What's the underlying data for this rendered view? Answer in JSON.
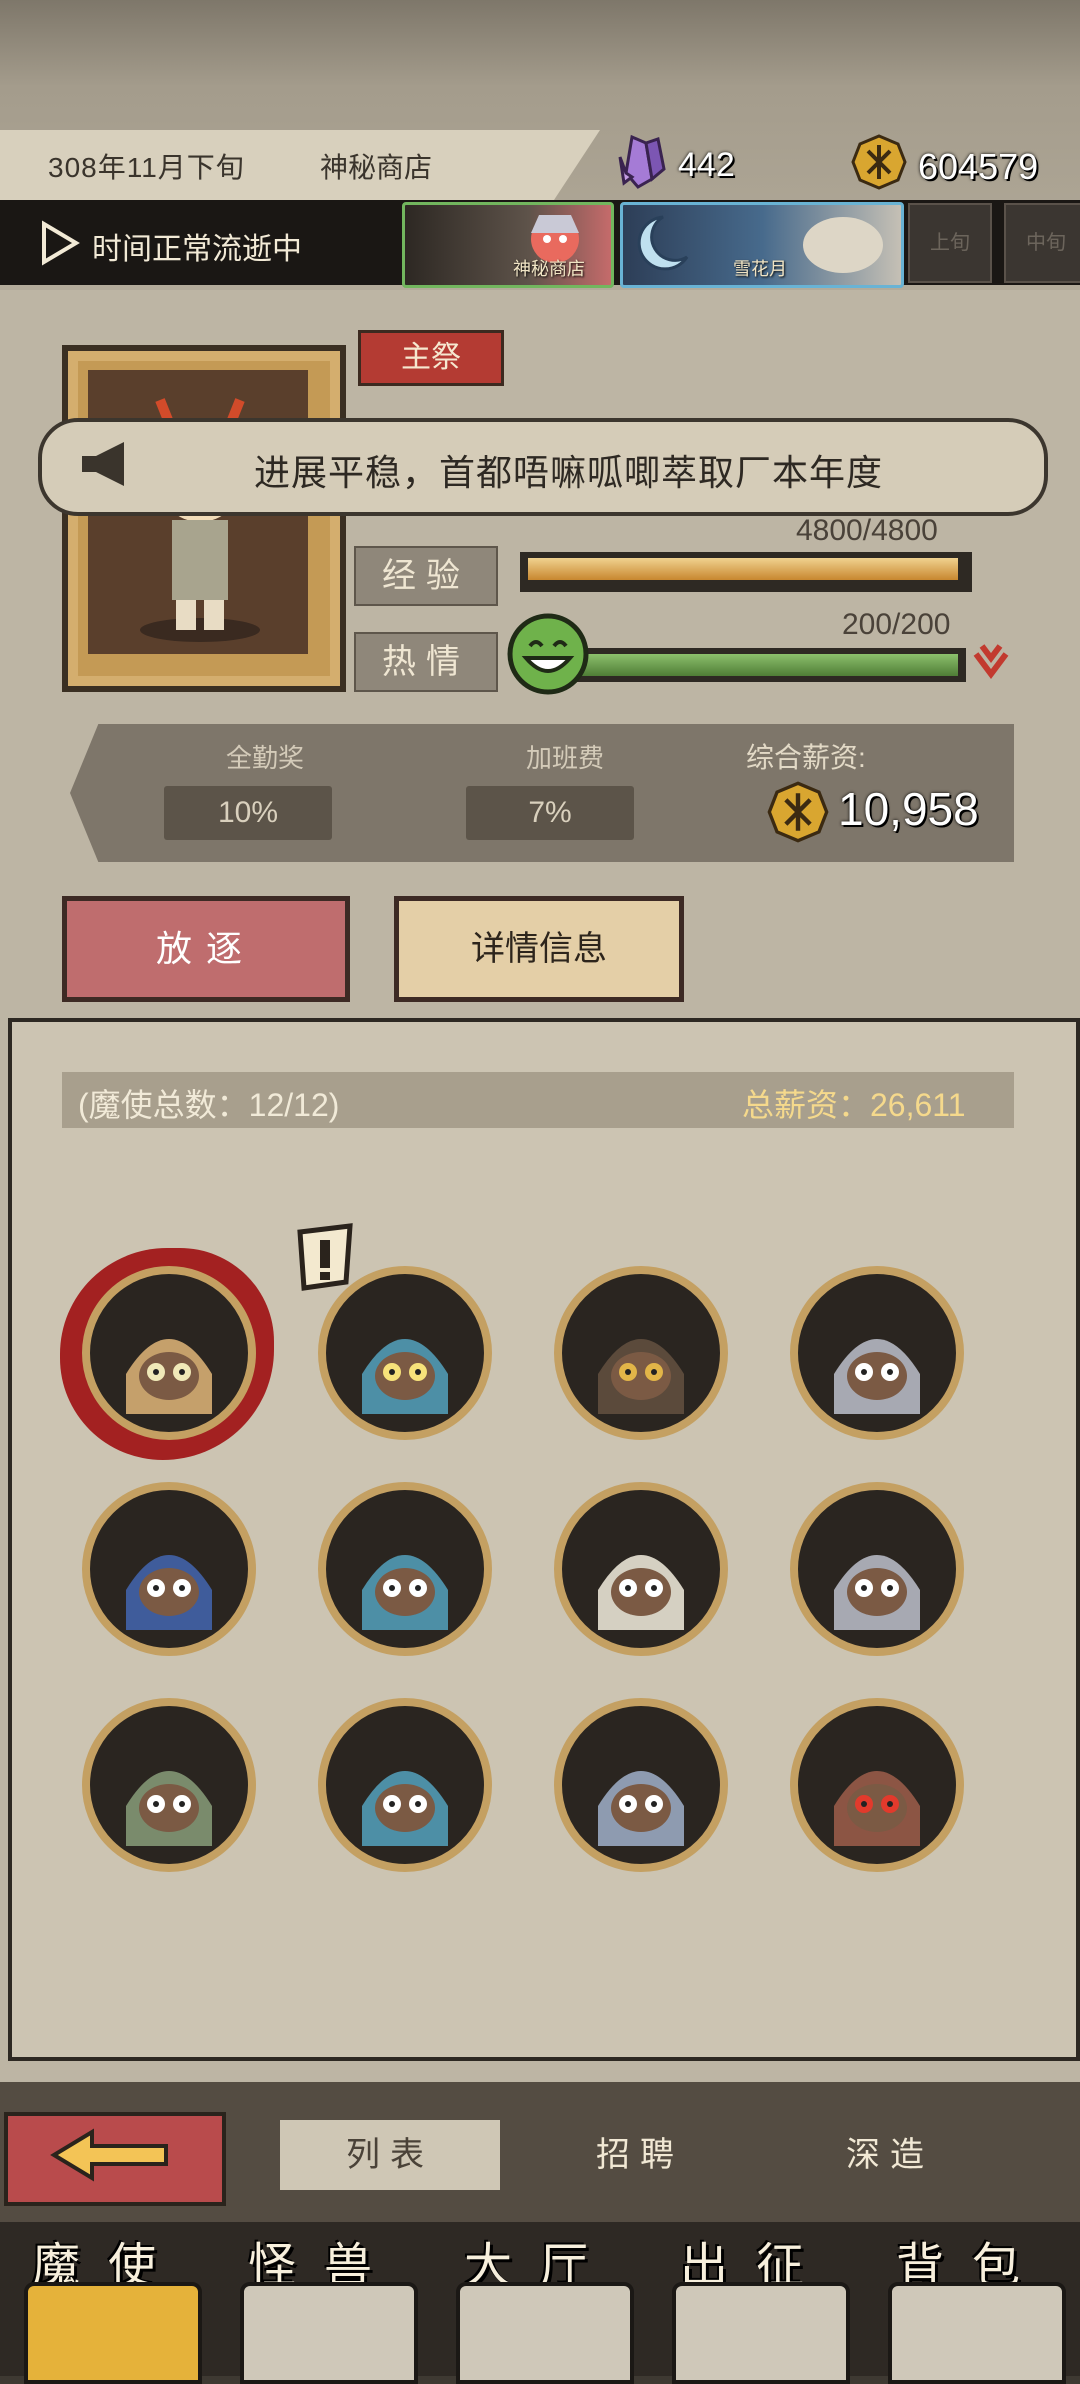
{
  "header": {
    "date": "308年11月下旬",
    "location": "神秘商店",
    "crystals": "442",
    "coins": "604579"
  },
  "time_bar": {
    "status": "时间正常流逝中",
    "events": [
      "神秘商店",
      "雪花月"
    ],
    "periods": [
      "上旬",
      "中旬"
    ]
  },
  "character": {
    "role": "主祭",
    "news": "进展平稳，首都唔嘛呱唧萃取厂本年度",
    "exp_label": "经验",
    "exp_value": "4800/4800",
    "exp_ratio": 1.0,
    "passion_label": "热情",
    "passion_value": "200/200",
    "passion_ratio": 1.0
  },
  "salary": {
    "attendance_label": "全勤奖",
    "attendance_value": "10%",
    "overtime_label": "加班费",
    "overtime_value": "7%",
    "total_label": "综合薪资:",
    "total_value": "10,958"
  },
  "actions": {
    "exile": "放逐",
    "details": "详情信息"
  },
  "roster": {
    "count": "(魔使总数：12/12)",
    "total_salary": "总薪资：26,611",
    "mages": [
      {
        "hood": "#c5a06b",
        "eyes": "#f0e9b8"
      },
      {
        "hood": "#4d8fa6",
        "eyes": "#f7e27a"
      },
      {
        "hood": "#5b4a3b",
        "eyes": "#e2b548"
      },
      {
        "hood": "#a7a9b2",
        "eyes": "#ffffff"
      },
      {
        "hood": "#3f5c9b",
        "eyes": "#ffffff"
      },
      {
        "hood": "#4d8fa6",
        "eyes": "#ffffff"
      },
      {
        "hood": "#d5d0c2",
        "eyes": "#ffffff"
      },
      {
        "hood": "#a7a9b2",
        "eyes": "#ffffff"
      },
      {
        "hood": "#7a8b6c",
        "eyes": "#ffffff"
      },
      {
        "hood": "#4d8fa6",
        "eyes": "#ffffff"
      },
      {
        "hood": "#8e9bb0",
        "eyes": "#ffffff"
      },
      {
        "hood": "#8c5544",
        "eyes": "#e23a2c"
      }
    ]
  },
  "subtabs": {
    "list": "列表",
    "recruit": "招聘",
    "forge": "深造"
  },
  "nav": {
    "mage": "魔使",
    "monster": "怪兽",
    "hall": "大厅",
    "expedition": "出征",
    "bag": "背包"
  }
}
